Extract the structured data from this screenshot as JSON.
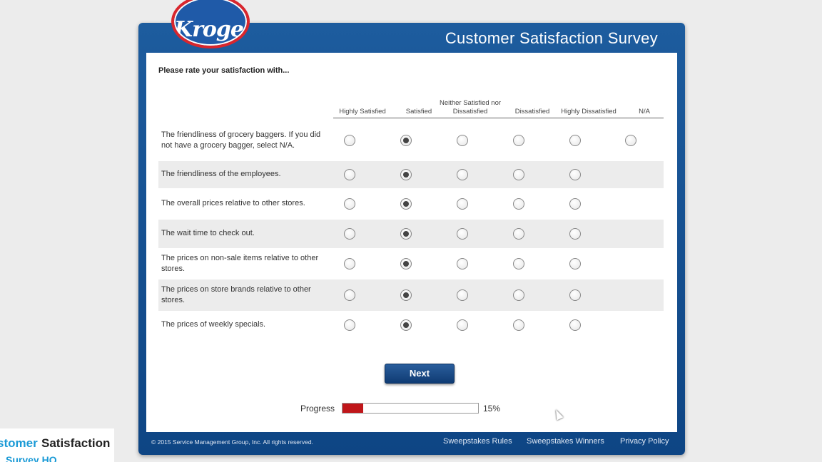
{
  "header": {
    "logo_text": "Kroger",
    "title": "Customer Satisfaction Survey"
  },
  "prompt": "Please rate your satisfaction with...",
  "columns": [
    "Highly Satisfied",
    "Satisfied",
    "Neither Satisfied nor Dissatisfied",
    "Dissatisfied",
    "Highly Dissatisfied",
    "N/A"
  ],
  "questions": [
    {
      "text": "The friendliness of grocery baggers. If you did not have a grocery bagger, select N/A.",
      "selected": "Satisfied",
      "has_na": true
    },
    {
      "text": "The friendliness of the employees.",
      "selected": "Satisfied",
      "has_na": false
    },
    {
      "text": "The overall prices relative to other stores.",
      "selected": "Satisfied",
      "has_na": false
    },
    {
      "text": "The wait time to check out.",
      "selected": "Satisfied",
      "has_na": false
    },
    {
      "text": "The prices on non-sale items relative to other stores.",
      "selected": "Satisfied",
      "has_na": false
    },
    {
      "text": "The prices on store brands relative to other stores.",
      "selected": "Satisfied",
      "has_na": false
    },
    {
      "text": "The prices of weekly specials.",
      "selected": "Satisfied",
      "has_na": false
    }
  ],
  "next_label": "Next",
  "progress": {
    "label": "Progress",
    "value_text": "15%",
    "fraction": 0.15,
    "fill_color": "#c0161a"
  },
  "footer": {
    "copyright": "© 2015 Service Management Group, Inc. All rights reserved.",
    "links": [
      "Sweepstakes Rules",
      "Sweepstakes Winners",
      "Privacy Policy"
    ]
  },
  "watermark": {
    "line1a": "stomer",
    "line1b": "Satisfaction",
    "line2": "Survey HQ"
  },
  "colors": {
    "frame_blue": "#0e4584",
    "accent_red": "#d8262d"
  }
}
